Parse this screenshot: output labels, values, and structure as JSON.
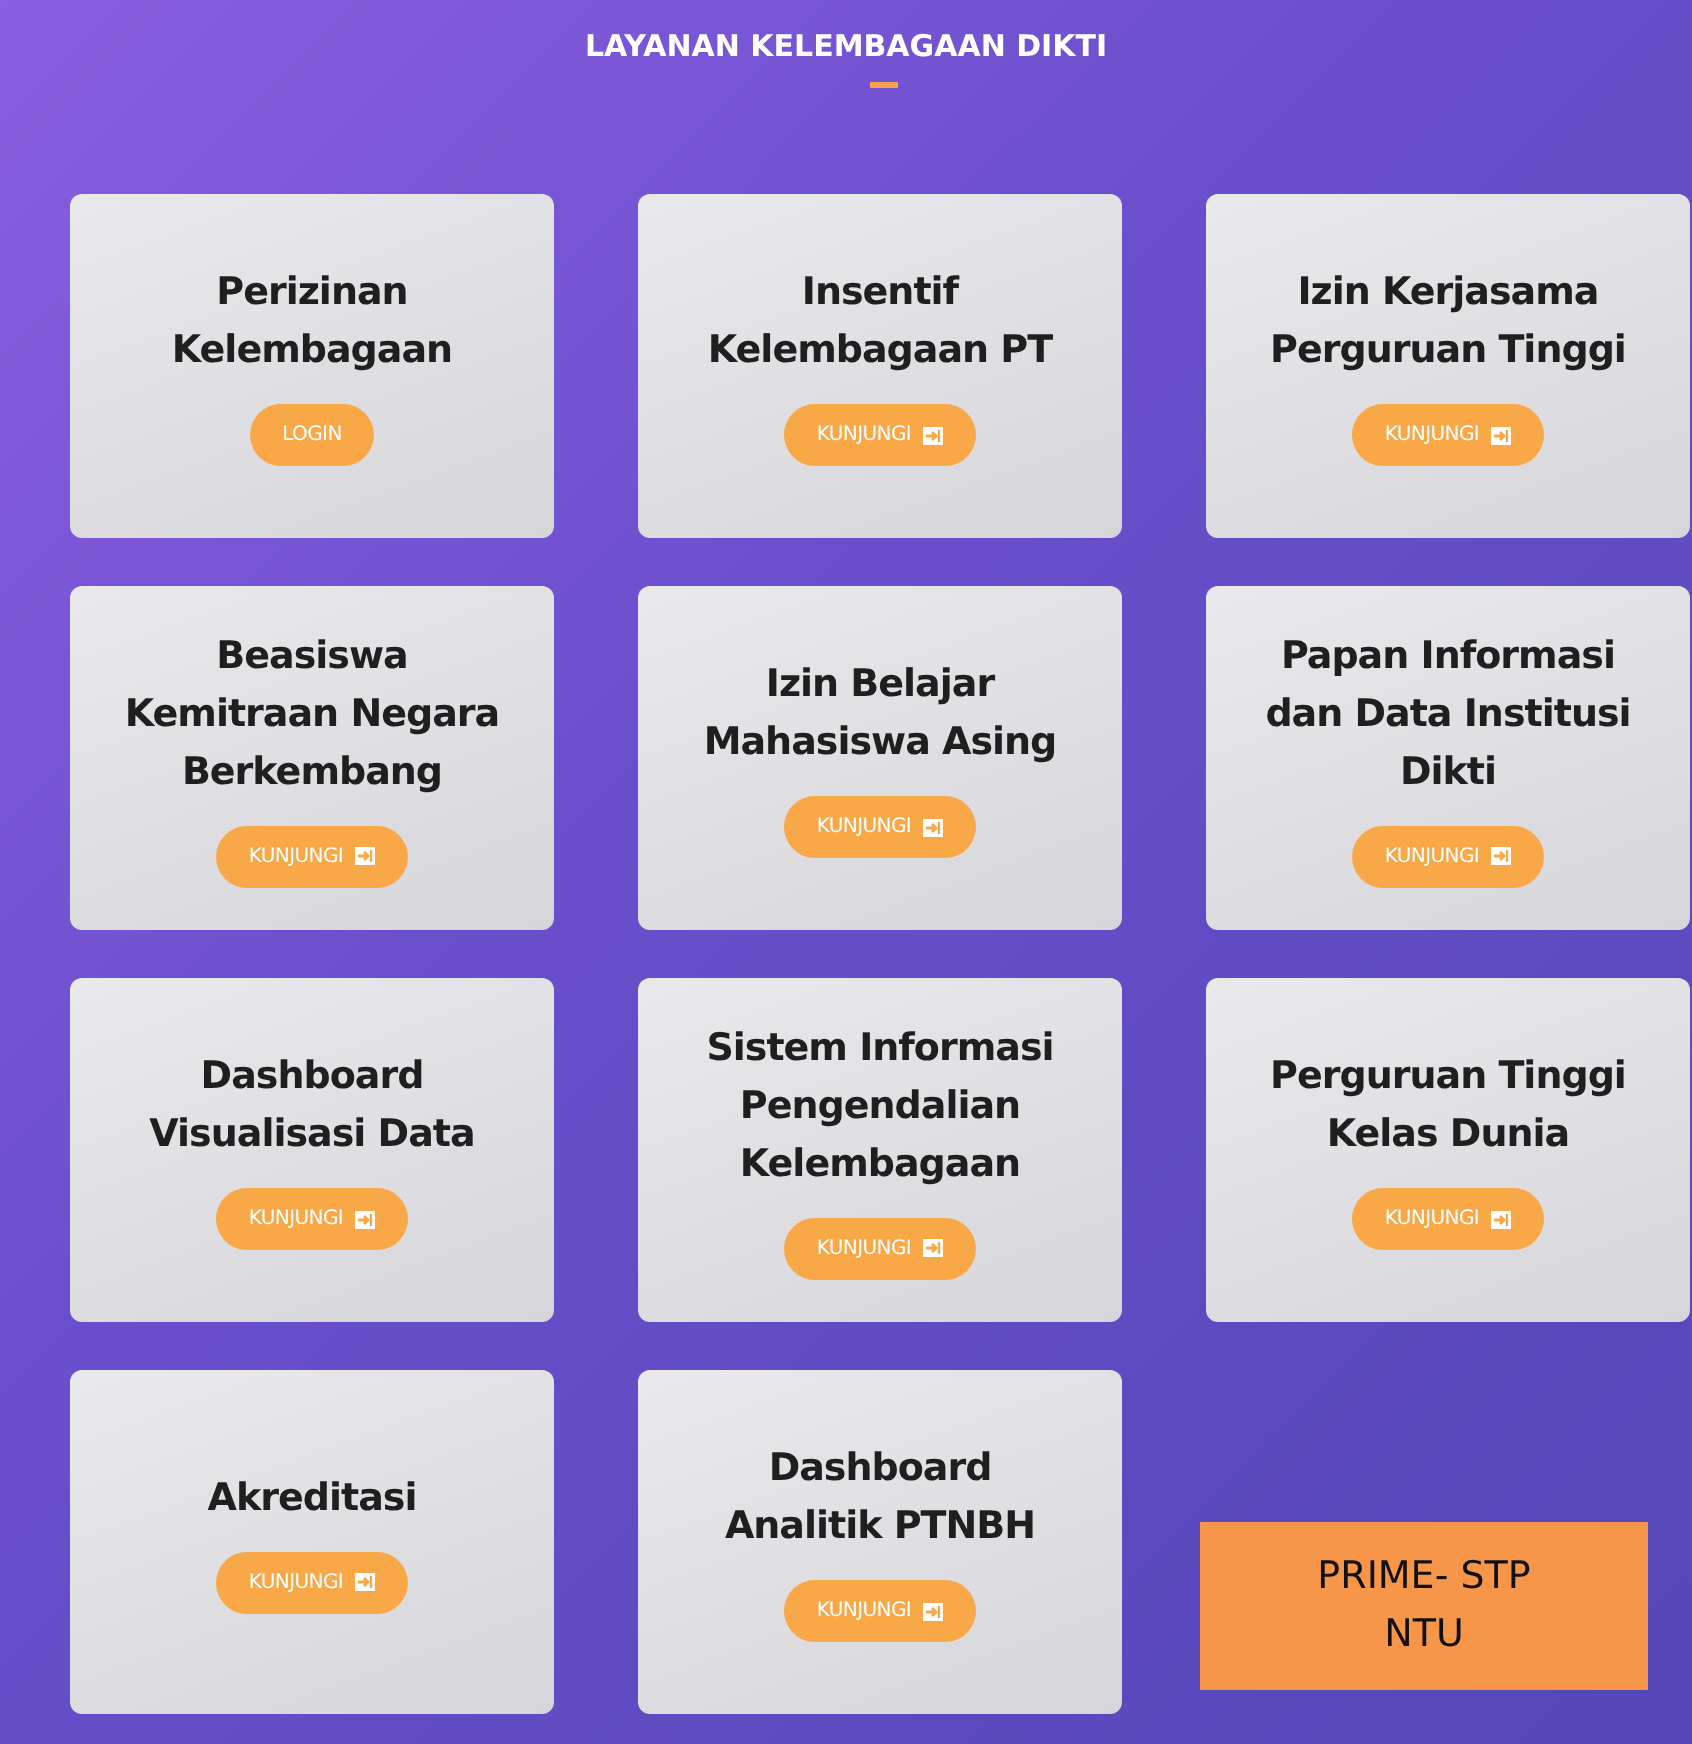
{
  "section_title": "LAYANAN KELEMBAGAAN DIKTI",
  "cards": [
    {
      "title_lines": [
        "Perizinan",
        "Kelembagaan"
      ],
      "button": {
        "label": "LOGIN",
        "kind": "plain"
      }
    },
    {
      "title_lines": [
        "Insentif",
        "Kelembagaan PT"
      ],
      "button": {
        "label": "KUNJUNGI",
        "kind": "enter"
      }
    },
    {
      "title_lines": [
        "Izin Kerjasama",
        "Perguruan Tinggi"
      ],
      "button": {
        "label": "KUNJUNGI",
        "kind": "enter"
      }
    },
    {
      "title_lines": [
        "Beasiswa",
        "Kemitraan Negara",
        "Berkembang"
      ],
      "button": {
        "label": "KUNJUNGI",
        "kind": "enter"
      }
    },
    {
      "title_lines": [
        "Izin Belajar",
        "Mahasiswa Asing"
      ],
      "button": {
        "label": "KUNJUNGI",
        "kind": "enter"
      }
    },
    {
      "title_lines": [
        "Papan Informasi",
        "dan Data Institusi",
        "Dikti"
      ],
      "button": {
        "label": "KUNJUNGI",
        "kind": "enter"
      }
    },
    {
      "title_lines": [
        "Dashboard",
        "Visualisasi Data"
      ],
      "button": {
        "label": "KUNJUNGI",
        "kind": "enter"
      }
    },
    {
      "title_lines": [
        "Sistem Informasi",
        "Pengendalian",
        "Kelembagaan"
      ],
      "button": {
        "label": "KUNJUNGI",
        "kind": "enter"
      }
    },
    {
      "title_lines": [
        "Perguruan Tinggi",
        "Kelas Dunia"
      ],
      "button": {
        "label": "KUNJUNGI",
        "kind": "enter"
      }
    },
    {
      "title_lines": [
        "Akreditasi"
      ],
      "button": {
        "label": "KUNJUNGI",
        "kind": "enter"
      }
    },
    {
      "title_lines": [
        "Dashboard",
        "Analitik PTNBH"
      ],
      "button": {
        "label": "KUNJUNGI",
        "kind": "enter"
      }
    }
  ],
  "callout": {
    "lines": [
      "PRIME- STP",
      "NTU"
    ]
  }
}
